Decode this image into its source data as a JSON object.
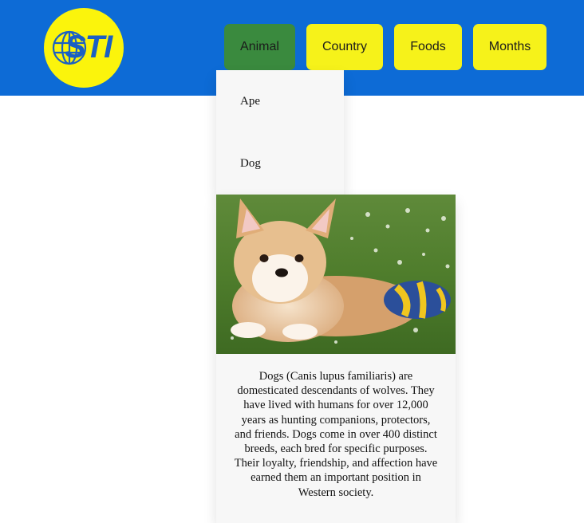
{
  "header": {
    "logo_text": "STI",
    "nav": [
      {
        "label": "Animal",
        "active": true
      },
      {
        "label": "Country",
        "active": false
      },
      {
        "label": "Foods",
        "active": false
      },
      {
        "label": "Months",
        "active": false
      }
    ]
  },
  "dropdown": {
    "items": [
      {
        "label": "Ape"
      },
      {
        "label": "Dog"
      }
    ]
  },
  "card": {
    "image": "corgi-puppy-with-ball",
    "description": "Dogs (Canis lupus familiaris) are domesticated descendants of wolves. They have lived with humans for over 12,000 years as hunting companions, protectors, and friends. Dogs come in over 400 distinct breeds, each bred for specific purposes. Their loyalty, friendship, and affection have earned them an important position in Western society."
  },
  "colors": {
    "header_bg": "#0d6bd6",
    "nav_bg": "#f6f21a",
    "nav_active_bg": "#3a8a3e",
    "logo_bg": "#fbf40c",
    "logo_text": "#1a5fc4"
  }
}
